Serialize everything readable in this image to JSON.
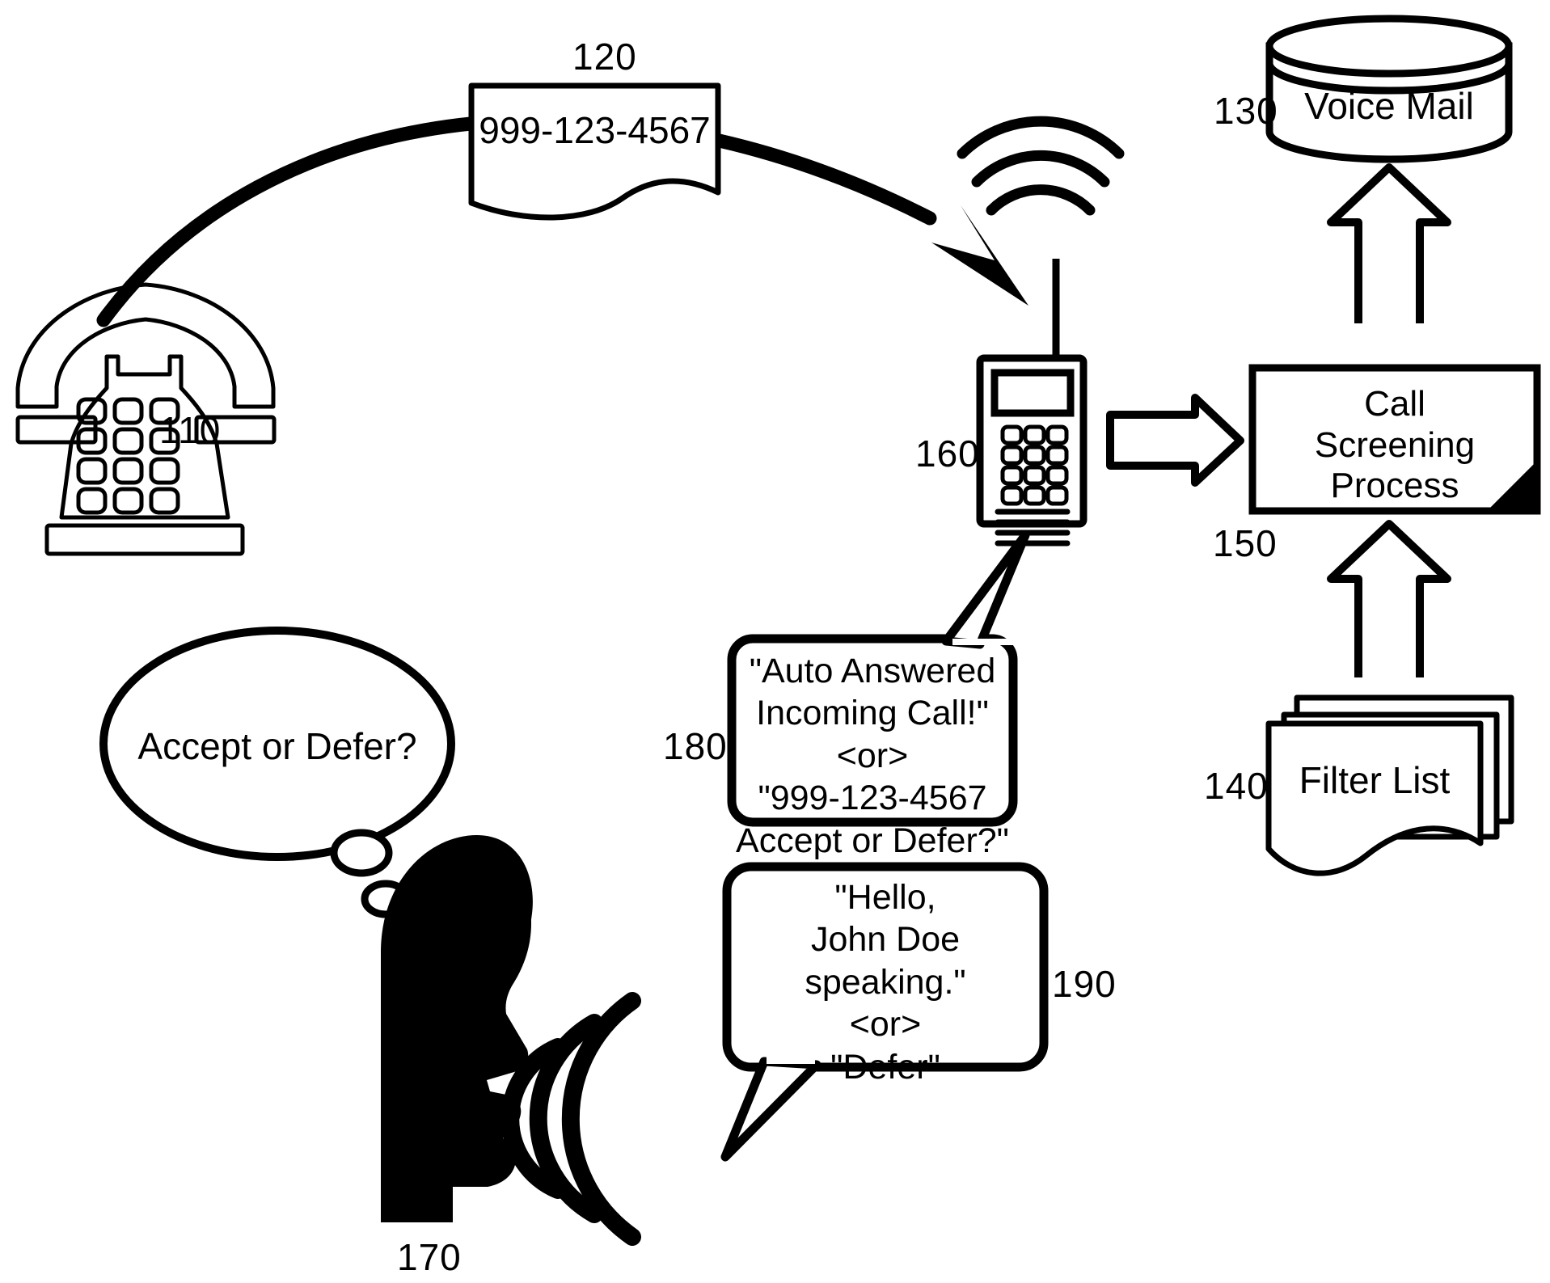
{
  "figure": {
    "type": "patent-diagram",
    "title": "Call screening process flow diagram",
    "background_color": "#ffffff",
    "line_color": "#000000"
  },
  "nodes": {
    "caller_phone": {
      "ref": "110",
      "icon": "desk-telephone-icon",
      "label": ""
    },
    "caller_id": {
      "ref": "120",
      "label": "999-123-4567",
      "shape": "document-torn-bottom"
    },
    "voice_mail": {
      "ref": "130",
      "label": "Voice Mail",
      "shape": "cylinder-database"
    },
    "filter_list": {
      "ref": "140",
      "label": "Filter List",
      "shape": "stacked-documents"
    },
    "call_screening": {
      "ref": "150",
      "label": "Call\nScreening\nProcess",
      "line1": "Call",
      "line2": "Screening",
      "line3": "Process",
      "shape": "rect-folded-corner"
    },
    "mobile_device": {
      "ref": "160",
      "icon": "mobile-phone-icon",
      "label": ""
    },
    "person": {
      "ref": "170",
      "icon": "speaking-head-silhouette-icon",
      "label": ""
    },
    "device_announcement": {
      "ref": "180",
      "shape": "rounded-speech-bubble",
      "lines": [
        "\"Auto Answered",
        "Incoming Call!\"",
        "<or>",
        "\"999-123-4567",
        "Accept or Defer?\""
      ]
    },
    "user_response": {
      "ref": "190",
      "shape": "rounded-speech-bubble",
      "lines": [
        "\"Hello,",
        "John Doe",
        "speaking.\"",
        "<or>",
        "\"Defer\""
      ]
    },
    "thought": {
      "shape": "thought-bubble-ellipse",
      "label": "Accept or Defer?"
    }
  },
  "connectors": {
    "call_arc": {
      "from": "caller_phone",
      "to": "mobile_device",
      "style": "thick-curved-arrow"
    },
    "device_to_screening": {
      "from": "mobile_device",
      "to": "call_screening",
      "style": "hollow-block-arrow-right"
    },
    "screening_to_voicemail": {
      "from": "call_screening",
      "to": "voice_mail",
      "style": "hollow-block-arrow-up"
    },
    "filterlist_to_screening": {
      "from": "filter_list",
      "to": "call_screening",
      "style": "hollow-block-arrow-up"
    }
  },
  "ref_labels": {
    "n110": "110",
    "n120": "120",
    "n130": "130",
    "n140": "140",
    "n150": "150",
    "n160": "160",
    "n170": "170",
    "n180": "180",
    "n190": "190"
  }
}
